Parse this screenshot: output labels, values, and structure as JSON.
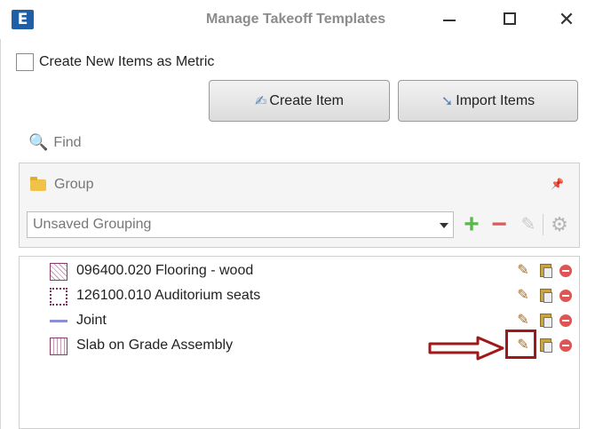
{
  "window": {
    "logo_letter": "E",
    "title": "Manage Takeoff Templates",
    "close_glyph": "✕"
  },
  "metric": {
    "checked": false,
    "label": "Create New Items as Metric"
  },
  "buttons": {
    "create_label": "Create Item",
    "import_label": "Import Items"
  },
  "find": {
    "label": "Find"
  },
  "group": {
    "label": "Group",
    "selected_grouping": "Unsaved Grouping"
  },
  "items": [
    {
      "label": "096400.020 Flooring - wood",
      "swatch": "hatched"
    },
    {
      "label": "126100.010 Auditorium seats",
      "swatch": "dotted-border"
    },
    {
      "label": "Joint",
      "swatch": "line"
    },
    {
      "label": "Slab on Grade Assembly",
      "swatch": "vertical-lines"
    }
  ],
  "colors": {
    "highlight": "#a01818",
    "add": "#58b84a",
    "remove": "#e05a5a",
    "app_logo": "#1f5fa8"
  }
}
